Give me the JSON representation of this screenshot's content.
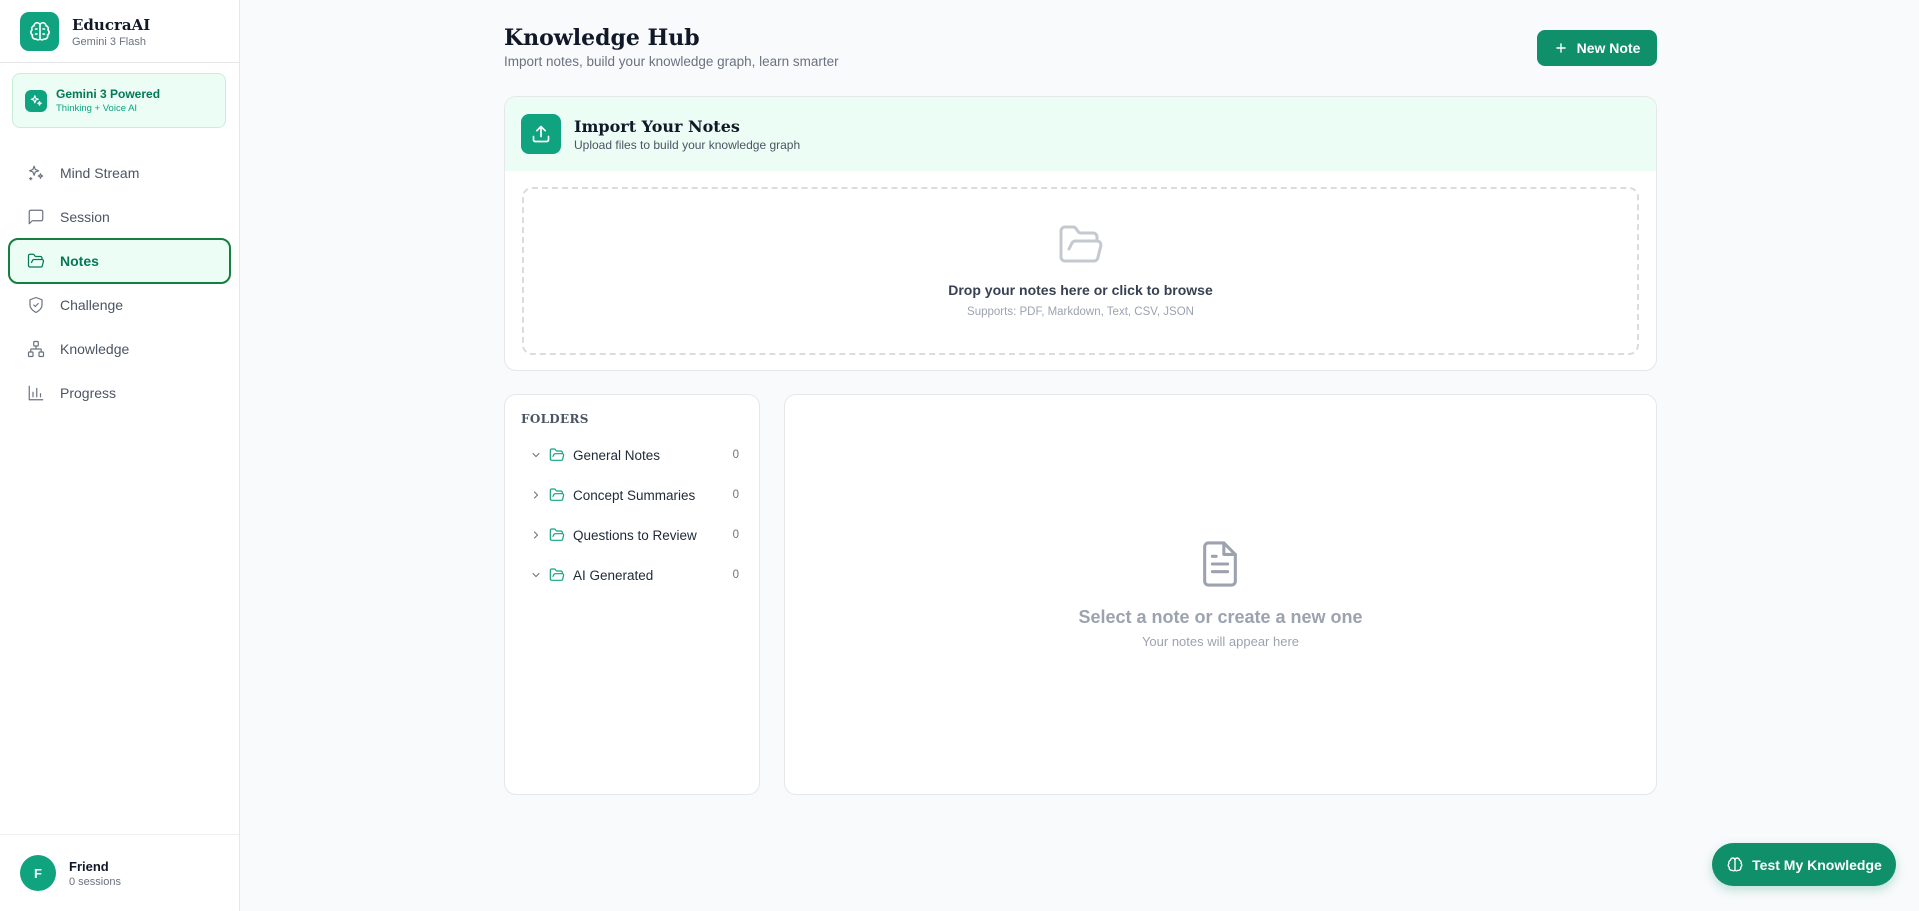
{
  "brand": {
    "name": "EducraAI",
    "subtitle": "Gemini 3 Flash"
  },
  "powered": {
    "title": "Gemini 3 Powered",
    "subtitle": "Thinking + Voice AI"
  },
  "nav": {
    "items": [
      {
        "label": "Mind Stream",
        "icon": "sparkles-icon",
        "active": false
      },
      {
        "label": "Session",
        "icon": "chat-icon",
        "active": false
      },
      {
        "label": "Notes",
        "icon": "folder-open-icon",
        "active": true
      },
      {
        "label": "Challenge",
        "icon": "shield-check-icon",
        "active": false
      },
      {
        "label": "Knowledge",
        "icon": "network-icon",
        "active": false
      },
      {
        "label": "Progress",
        "icon": "bar-chart-icon",
        "active": false
      }
    ]
  },
  "user": {
    "initial": "F",
    "name": "Friend",
    "sessions": "0 sessions"
  },
  "header": {
    "title": "Knowledge Hub",
    "subtitle": "Import notes, build your knowledge graph, learn smarter",
    "new_note_label": "New Note"
  },
  "import": {
    "title": "Import Your Notes",
    "subtitle": "Upload files to build your knowledge graph",
    "drop_text": "Drop your notes here or click to browse",
    "supports": "Supports: PDF, Markdown, Text, CSV, JSON"
  },
  "folders": {
    "title": "FOLDERS",
    "items": [
      {
        "name": "General Notes",
        "count": "0",
        "expanded": true
      },
      {
        "name": "Concept Summaries",
        "count": "0",
        "expanded": false
      },
      {
        "name": "Questions to Review",
        "count": "0",
        "expanded": false
      },
      {
        "name": "AI Generated",
        "count": "0",
        "expanded": true
      }
    ]
  },
  "preview": {
    "title": "Select a note or create a new one",
    "subtitle": "Your notes will appear here"
  },
  "fab": {
    "label": "Test My Knowledge"
  },
  "colors": {
    "accent": "#10a37f",
    "accent_dark": "#0f8f6a",
    "active_border": "#15803d"
  }
}
